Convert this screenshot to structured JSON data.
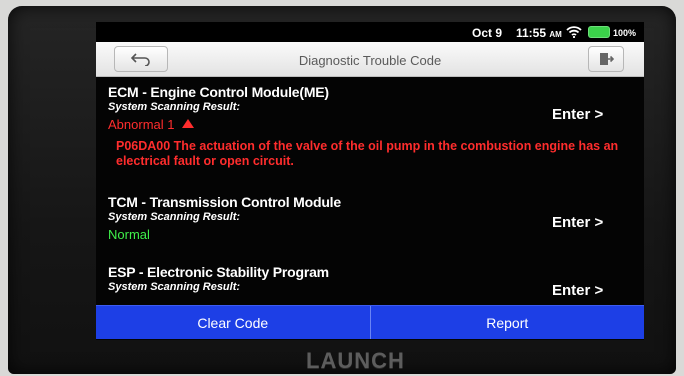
{
  "status_bar": {
    "date": "Oct 9",
    "time": "11:55",
    "ampm": "AM",
    "battery": "100%"
  },
  "header": {
    "title": "Diagnostic Trouble Code"
  },
  "modules": [
    {
      "name": "ECM - Engine Control Module(ME)",
      "scan_label": "System Scanning Result:",
      "status": "Abnormal 1",
      "fault_code": "P06DA00 The actuation of the valve of the oil pump in the combustion engine has an electrical fault or open circuit.",
      "enter": "Enter >"
    },
    {
      "name": "TCM - Transmission Control Module",
      "scan_label": "System Scanning Result:",
      "status": "Normal",
      "enter": "Enter >"
    },
    {
      "name": "ESP - Electronic Stability Program",
      "scan_label": "System Scanning Result:",
      "enter": "Enter >"
    }
  ],
  "actions": {
    "clear_code": "Clear Code",
    "report": "Report"
  },
  "brand": "LAUNCH",
  "colors": {
    "abnormal": "#ff2d2d",
    "normal": "#3ff04a",
    "action_bar": "#1d3fe6"
  },
  "icons": [
    "wifi-icon",
    "battery-icon",
    "back-arrow-icon",
    "exit-icon",
    "up-arrow-icon"
  ]
}
